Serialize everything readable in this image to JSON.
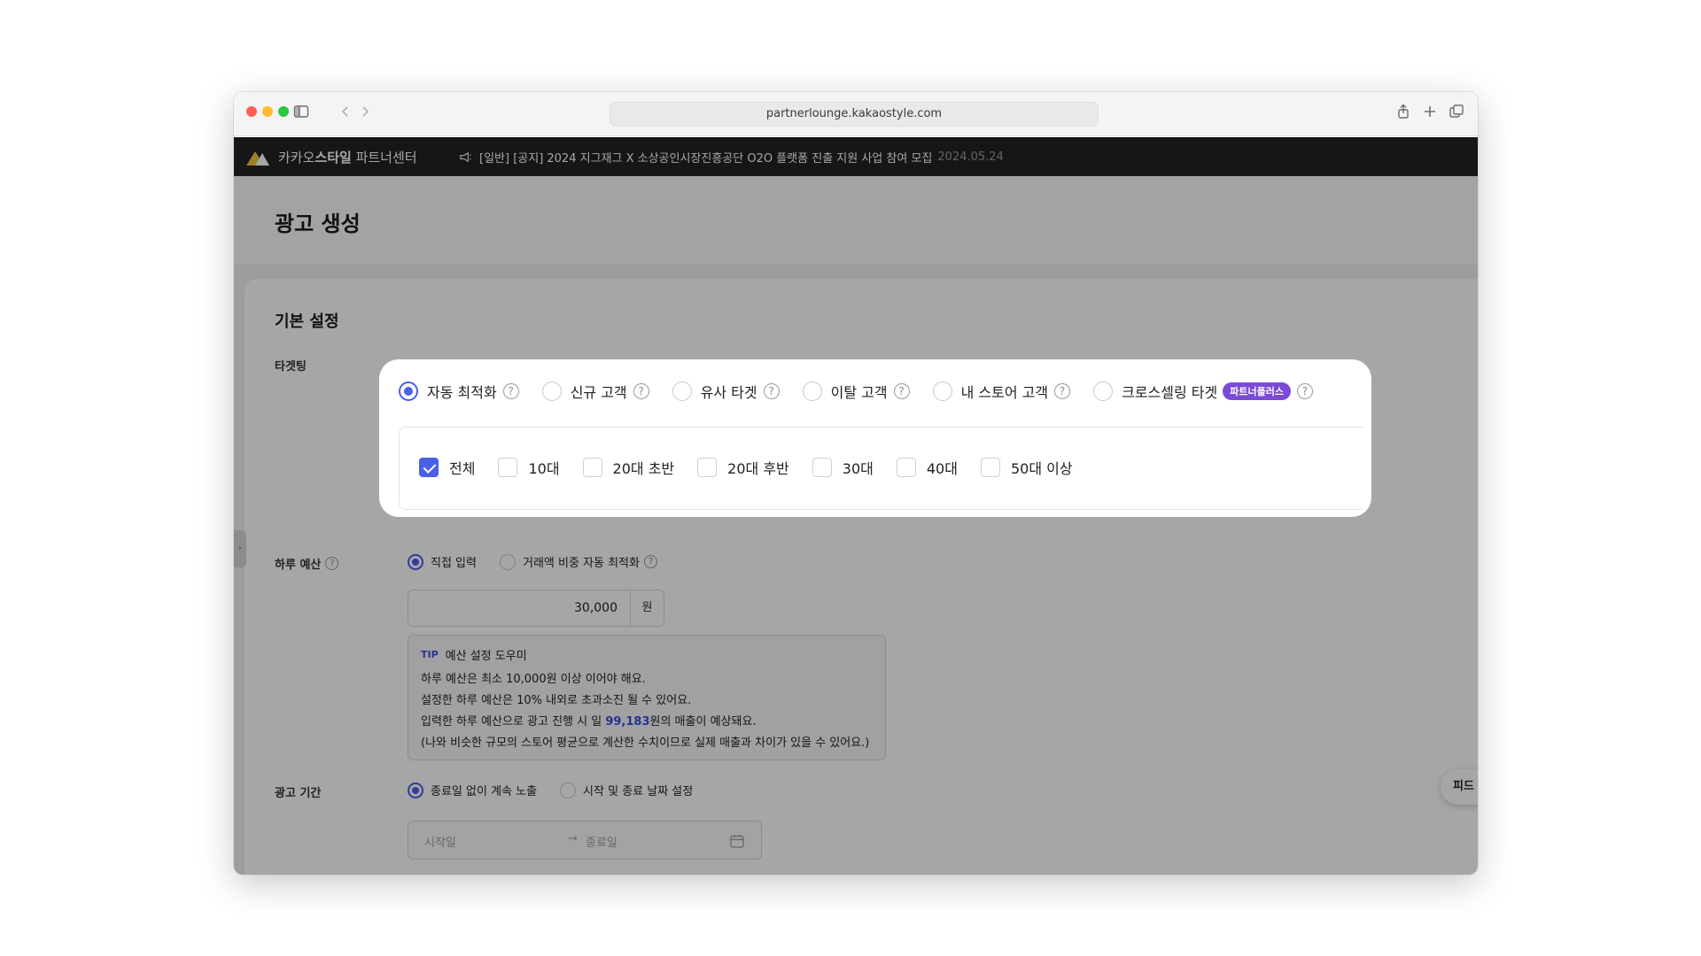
{
  "browser": {
    "url": "partnerlounge.kakaostyle.com"
  },
  "topbar": {
    "brand_prefix": "카카오",
    "brand_bold": "스타일",
    "brand_suffix": " 파트너센터",
    "notice_text": "[일반] [공지] 2024 지그재그 X 소상공인시장진흥공단 O2O 플랫폼 진출 지원 사업 참여 모집",
    "notice_date": "2024.05.24"
  },
  "page": {
    "title": "광고 생성"
  },
  "basic": {
    "section_title": "기본 설정",
    "targeting_label": "타겟팅",
    "budget_label": "하루 예산",
    "budget_options": [
      "직접 입력",
      "거래액 비중 자동 최적화"
    ],
    "budget_value": "30,000",
    "budget_unit": "원",
    "tip": {
      "tag": "TIP",
      "title": "예산 설정 도우미",
      "line1": "하루 예산은 최소 10,000원 이상 이어야 해요.",
      "line2": "설정한 하루 예산은 10% 내외로 초과소진 될 수 있어요.",
      "line3_pre": "입력한 하루 예산으로 광고 진행 시 일 ",
      "line3_value": "99,183",
      "line3_post": "원의 매출이 예상돼요.",
      "line4": "(나와 비슷한 규모의 스토어 평균으로 계산한 수치이므로 실제 매출과 차이가 있을 수 있어요.)"
    },
    "period_label": "광고 기간",
    "period_options": [
      "종료일 없이 계속 노출",
      "시작 및 종료 날짜 설정"
    ],
    "start_placeholder": "시작일",
    "end_placeholder": "종료일"
  },
  "popup": {
    "targets": [
      "자동 최적화",
      "신규 고객",
      "유사 타겟",
      "이탈 고객",
      "내 스토어 고객",
      "크로스셀링 타겟"
    ],
    "badge": "파트너플러스",
    "ages": [
      "전체",
      "10대",
      "20대 초반",
      "20대 후반",
      "30대",
      "40대",
      "50대 이상"
    ]
  },
  "feedback_label": "피드",
  "help_mark": "?"
}
